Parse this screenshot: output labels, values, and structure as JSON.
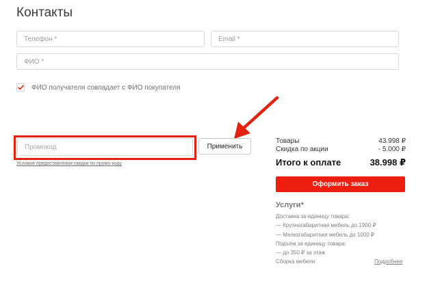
{
  "contacts": {
    "title": "Контакты",
    "phone_placeholder": "Телефон *",
    "email_placeholder": "Email *",
    "fio_placeholder": "ФИО *",
    "same_fio_label": "ФИО получателя совпадает с ФИО покупателя",
    "same_fio_checked": true
  },
  "promo": {
    "placeholder": "Промокод",
    "apply_label": "Применить",
    "terms_link": "Условия предоставления скидки по промо-коду"
  },
  "summary": {
    "goods_label": "Товары",
    "goods_value": "43.998 ₽",
    "discount_label": "Скидка по акции",
    "discount_value": "- 5.000 ₽",
    "total_label": "Итого к оплате",
    "total_value": "38.998 ₽",
    "order_button": "Оформить заказ"
  },
  "services": {
    "title": "Услуги*",
    "lines": [
      "Доставка за единицу товара:",
      "— Крупногабаритная мебель до 1900 ₽",
      "— Мелкогабаритная мебель до 1000 ₽",
      "Подъём за единицу товара:",
      "— до 350 ₽ за этаж",
      "Сборка мебели"
    ],
    "more_link": "Подробнее"
  },
  "colors": {
    "accent_red": "#ee1e10",
    "annotation_red": "#e3230f"
  },
  "icons": {
    "checkbox": "checkmark-icon",
    "annotation": "red-arrow-icon"
  }
}
